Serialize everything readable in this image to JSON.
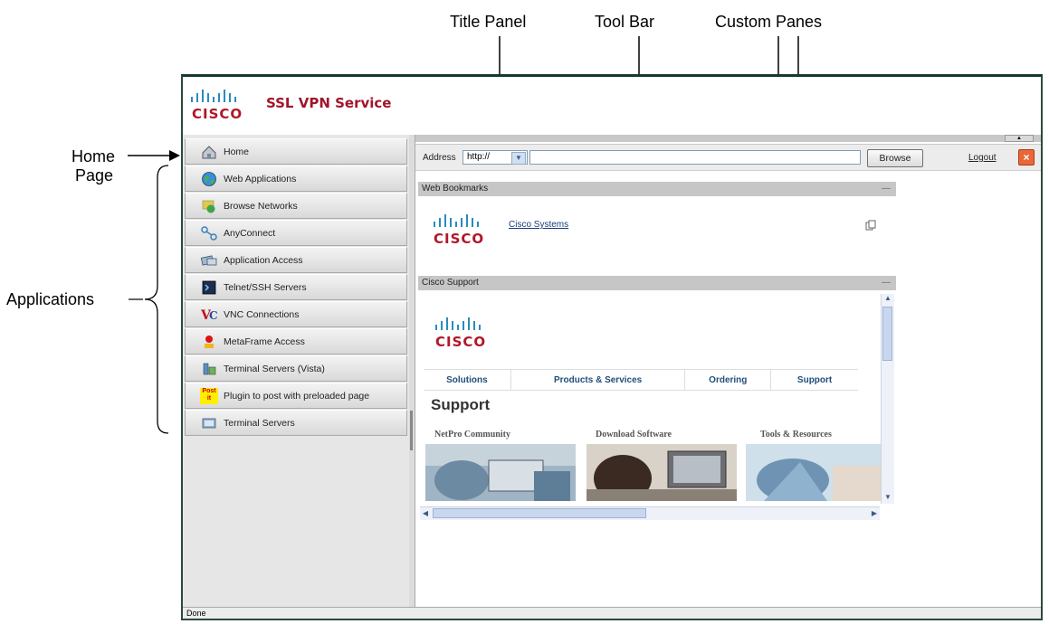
{
  "annotations": {
    "title_panel": "Title Panel",
    "tool_bar": "Tool Bar",
    "custom_panes": "Custom Panes",
    "home_page": "Home",
    "home_page_2": "Page",
    "applications": "Applications"
  },
  "header": {
    "logo_text": "CISCO",
    "service_title": "SSL VPN Service"
  },
  "sidebar": {
    "items": [
      {
        "label": "Home",
        "icon": "home-icon"
      },
      {
        "label": "Web Applications",
        "icon": "globe-icon"
      },
      {
        "label": "Browse Networks",
        "icon": "network-icon"
      },
      {
        "label": "AnyConnect",
        "icon": "anyconnect-icon"
      },
      {
        "label": "Application Access",
        "icon": "app-access-icon"
      },
      {
        "label": "Telnet/SSH Servers",
        "icon": "terminal-icon"
      },
      {
        "label": "VNC Connections",
        "icon": "vnc-icon"
      },
      {
        "label": "MetaFrame Access",
        "icon": "metaframe-icon"
      },
      {
        "label": "Terminal Servers (Vista)",
        "icon": "terminal-server-icon"
      },
      {
        "label": "Plugin to post with preloaded page",
        "icon": "post-it-icon"
      },
      {
        "label": "Terminal Servers",
        "icon": "terminal-servers-icon"
      }
    ],
    "post_it_text": "Post it"
  },
  "toolbar": {
    "address_label": "Address",
    "protocol_value": "http://",
    "address_value": "",
    "browse_label": "Browse",
    "logout_label": "Logout"
  },
  "panes": {
    "bookmarks": {
      "title": "Web Bookmarks",
      "minimize": "—",
      "link_label": "Cisco Systems",
      "logo_text": "CISCO"
    },
    "support": {
      "title": "Cisco Support",
      "minimize": "—",
      "logo_text": "CISCO",
      "nav": [
        "Solutions",
        "Products & Services",
        "Ordering",
        "Support"
      ],
      "heading": "Support",
      "columns": [
        "NetPro Community",
        "Download Software",
        "Tools & Resources"
      ]
    }
  },
  "status_bar": {
    "text": "Done"
  },
  "colors": {
    "brand_red": "#a0162a",
    "pane_header": "#c6c6c6"
  }
}
